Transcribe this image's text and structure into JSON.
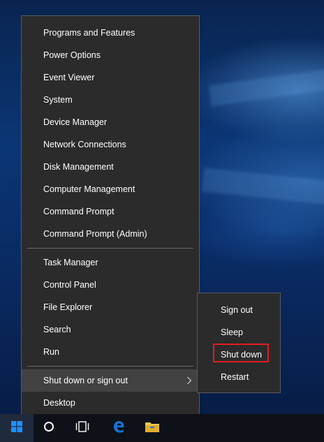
{
  "menu": {
    "items": [
      {
        "label": "Programs and Features"
      },
      {
        "label": "Power Options"
      },
      {
        "label": "Event Viewer"
      },
      {
        "label": "System"
      },
      {
        "label": "Device Manager"
      },
      {
        "label": "Network Connections"
      },
      {
        "label": "Disk Management"
      },
      {
        "label": "Computer Management"
      },
      {
        "label": "Command Prompt"
      },
      {
        "label": "Command Prompt (Admin)"
      },
      {
        "label": "Task Manager"
      },
      {
        "label": "Control Panel"
      },
      {
        "label": "File Explorer"
      },
      {
        "label": "Search"
      },
      {
        "label": "Run"
      },
      {
        "label": "Shut down or sign out"
      },
      {
        "label": "Desktop"
      }
    ]
  },
  "submenu": {
    "items": [
      {
        "label": "Sign out"
      },
      {
        "label": "Sleep"
      },
      {
        "label": "Shut down"
      },
      {
        "label": "Restart"
      }
    ],
    "highlighted": "Shut down"
  },
  "taskbar": {
    "icons": [
      "windows-start-icon",
      "cortana-circle-icon",
      "task-view-icon",
      "edge-browser-icon",
      "file-explorer-folder-icon"
    ]
  },
  "colors": {
    "menu_bg": "#2b2b2b",
    "menu_hover": "#424242",
    "highlight_border": "#e01e1e",
    "edge_blue": "#1a73d6",
    "folder_yellow": "#f2c94c"
  }
}
